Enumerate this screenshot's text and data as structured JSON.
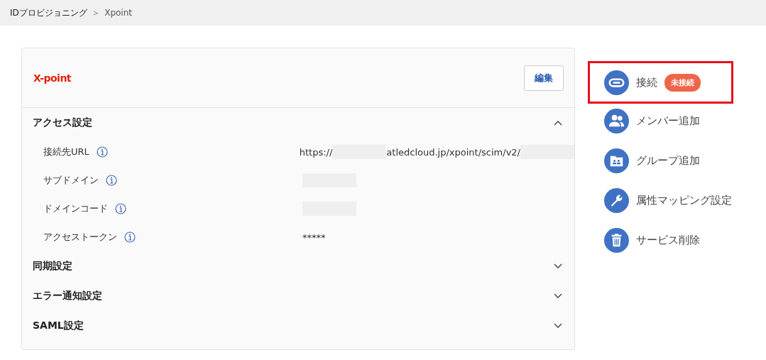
{
  "breadcrumb": [
    {
      "label": "IDプロビジョニング"
    },
    {
      "label": "Xpoint"
    }
  ],
  "breadcrumb_separator": ">",
  "card": {
    "logo": "X-point",
    "edit_button": "編集",
    "sections": [
      {
        "title": "アクセス設定",
        "expanded": true,
        "fields": [
          {
            "label": "接続先URL",
            "value_parts": [
              {
                "kind": "text",
                "text": "https://"
              },
              {
                "kind": "redacted"
              },
              {
                "kind": "text",
                "text": "atledcloud.jp/xpoint/scim/v2/"
              },
              {
                "kind": "redacted"
              }
            ]
          },
          {
            "label": "サブドメイン",
            "value_parts": [
              {
                "kind": "redacted"
              }
            ]
          },
          {
            "label": "ドメインコード",
            "value_parts": [
              {
                "kind": "redacted"
              }
            ]
          },
          {
            "label": "アクセストークン",
            "value_parts": [
              {
                "kind": "text",
                "text": "*****"
              }
            ]
          }
        ]
      },
      {
        "title": "同期設定",
        "expanded": false
      },
      {
        "title": "エラー通知設定",
        "expanded": false
      },
      {
        "title": "SAML設定",
        "expanded": false
      }
    ]
  },
  "actions": [
    {
      "kind": "link",
      "label": "接続",
      "badge": "未接続",
      "highlighted": true
    },
    {
      "kind": "members",
      "label": "メンバー追加",
      "highlighted": false
    },
    {
      "kind": "group",
      "label": "グループ追加",
      "highlighted": false
    },
    {
      "kind": "wrench",
      "label": "属性マッピング設定",
      "highlighted": false
    },
    {
      "kind": "trash",
      "label": "サービス削除",
      "highlighted": false
    }
  ]
}
